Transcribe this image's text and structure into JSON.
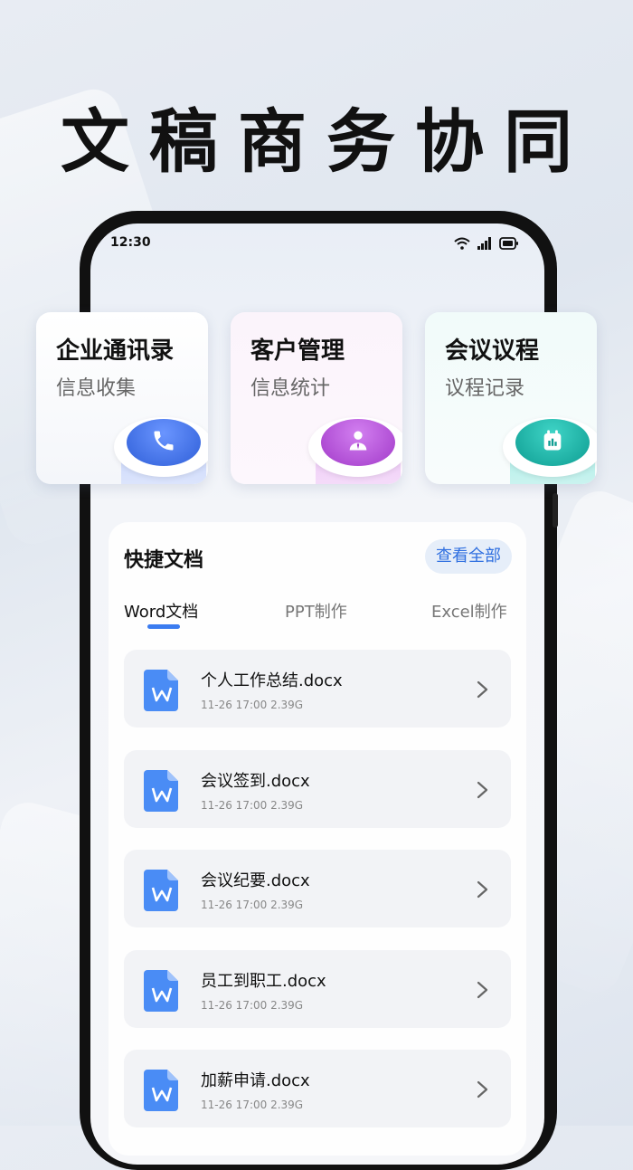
{
  "headline": "文稿商务协同",
  "status_bar": {
    "time": "12:30"
  },
  "feature_cards": [
    {
      "title": "企业通讯录",
      "subtitle": "信息收集",
      "icon": "phone-icon",
      "color": "#3f6fe8"
    },
    {
      "title": "客户管理",
      "subtitle": "信息统计",
      "icon": "person-icon",
      "color": "#b34fd8"
    },
    {
      "title": "会议议程",
      "subtitle": "议程记录",
      "icon": "calendar-chart-icon",
      "color": "#15b3a6"
    }
  ],
  "quick_docs": {
    "title": "快捷文档",
    "view_all": "查看全部",
    "tabs": [
      {
        "label": "Word文档",
        "active": true
      },
      {
        "label": "PPT制作",
        "active": false
      },
      {
        "label": "Excel制作",
        "active": false
      }
    ],
    "files": [
      {
        "name": "个人工作总结.docx",
        "meta": "11-26 17:00  2.39G"
      },
      {
        "name": "会议签到.docx",
        "meta": "11-26 17:00  2.39G"
      },
      {
        "name": "会议纪要.docx",
        "meta": "11-26 17:00  2.39G"
      },
      {
        "name": "员工到职工.docx",
        "meta": "11-26 17:00  2.39G"
      },
      {
        "name": "加薪申请.docx",
        "meta": "11-26 17:00  2.39G"
      }
    ]
  },
  "colors": {
    "accent": "#3b7cf0",
    "word_icon": "#3f86f3"
  }
}
